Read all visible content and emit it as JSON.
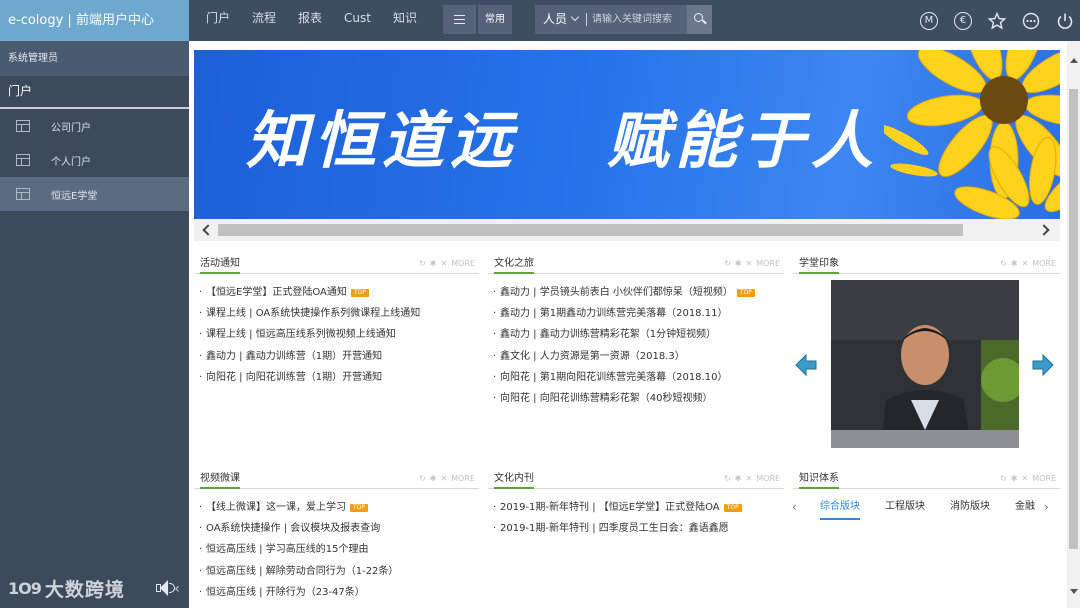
{
  "brand": "e-cology | 前端用户中心",
  "nav": [
    "门户",
    "流程",
    "报表",
    "Cust",
    "知识"
  ],
  "common_label": "常用",
  "search": {
    "scope": "人员",
    "placeholder": "请输入关键词搜索"
  },
  "top_icons": [
    "m-icon",
    "e-icon",
    "star-icon",
    "more-icon",
    "power-icon"
  ],
  "top_icon_glyphs": {
    "m": "M",
    "e": "€"
  },
  "sidebar": {
    "user": "系统管理员",
    "section": "门户",
    "items": [
      {
        "label": "公司门户",
        "active": false
      },
      {
        "label": "个人门户",
        "active": false
      },
      {
        "label": "恒远E学堂",
        "active": true
      }
    ]
  },
  "banner": {
    "slogan_left": "知恒道远",
    "slogan_right": "赋能于人"
  },
  "watermark": {
    "mark": "1O9",
    "text": "大数跨境"
  },
  "panel_tools": {
    "more": "MORE"
  },
  "tag_top": "TOP",
  "panels": {
    "activity": {
      "title": "活动通知",
      "items": [
        "【恒远E学堂】正式登陆OA通知",
        "课程上线 | OA系统快捷操作系列微课程上线通知",
        "课程上线 | 恒远高压线系列微视频上线通知",
        "鑫动力 | 鑫动力训练营（1期）开营通知",
        "向阳花 | 向阳花训练营（1期）开营通知"
      ]
    },
    "culture_trip": {
      "title": "文化之旅",
      "items": [
        "鑫动力 | 学员镜头前表白 小伙伴们都惊呆（短视频）",
        "鑫动力 | 第1期鑫动力训练营完美落幕（2018.11）",
        "鑫动力 | 鑫动力训练营精彩花絮（1分钟短视频）",
        "鑫文化 | 人力资源是第一资源（2018.3）",
        "向阳花 | 第1期向阳花训练营完美落幕（2018.10）",
        "向阳花 | 向阳花训练营精彩花絮（40秒短视频）"
      ]
    },
    "impression": {
      "title": "学堂印象"
    },
    "video": {
      "title": "视频微课",
      "items": [
        "【线上微课】这一课，爱上学习",
        "OA系统快捷操作 | 会议模块及报表查询",
        "恒远高压线 | 学习高压线的15个理由",
        "恒远高压线 | 解除劳动合同行为（1-22条）",
        "恒远高压线 | 开除行为（23-47条）"
      ]
    },
    "journal": {
      "title": "文化内刊",
      "items": [
        "2019-1期-新年特刊 | 【恒远E学堂】正式登陆OA",
        "2019-1期-新年特刊 | 四季度员工生日会：鑫语鑫愿"
      ]
    },
    "knowledge": {
      "title": "知识体系",
      "tabs": [
        "综合版块",
        "工程版块",
        "消防版块",
        "金融"
      ]
    }
  }
}
